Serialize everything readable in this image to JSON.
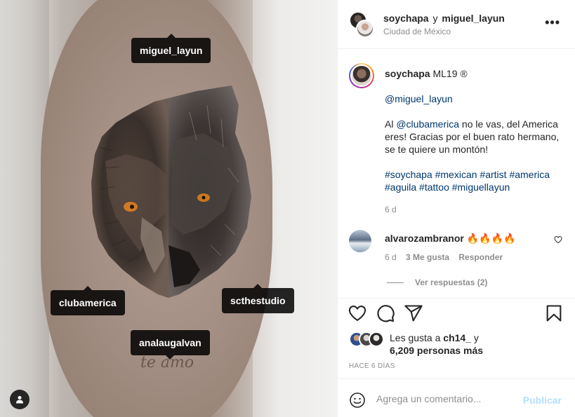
{
  "post": {
    "tags": {
      "top": "miguel_layun",
      "left": "clubamerica",
      "right": "scthestudio",
      "bottom": "analaugalvan"
    },
    "skin_text": "te amo"
  },
  "header": {
    "user1": "soychapa",
    "conjunction": "y",
    "user2": "miguel_layun",
    "location": "Ciudad de México",
    "more_icon": "more-icon"
  },
  "caption": {
    "username": "soychapa",
    "after_username": "ML19 ®",
    "mention": "@miguel_layun",
    "line_prefix": "Al ",
    "line_mention": "@clubamerica",
    "line_rest": " no le vas, del America eres! Gracias por el buen rato hermano, se te quiere un montón!",
    "hashtags": [
      "#soychapa",
      "#mexican",
      "#artist",
      "#america",
      "#aguila",
      "#tattoo",
      "#miguellayun"
    ],
    "time": "6 d"
  },
  "comment": {
    "username": "alvarozambranor",
    "text": "🔥🔥🔥🔥",
    "time": "6 d",
    "likes": "3 Me gusta",
    "reply": "Responder",
    "view_replies": "Ver respuestas (2)"
  },
  "actions": {
    "like_icon": "heart-icon",
    "comment_icon": "comment-icon",
    "share_icon": "share-icon",
    "save_icon": "bookmark-icon"
  },
  "likes": {
    "prefix": "Les gusta a ",
    "first_user": "ch14_",
    "connector": " y",
    "others": "6,209 personas más"
  },
  "posted": "HACE 6 DÍAS",
  "add_comment": {
    "placeholder": "Agrega un comentario...",
    "publish": "Publicar"
  },
  "colors": {
    "link": "#00376b",
    "muted": "#8e8e8e",
    "publish_disabled": "#b2dffc"
  }
}
